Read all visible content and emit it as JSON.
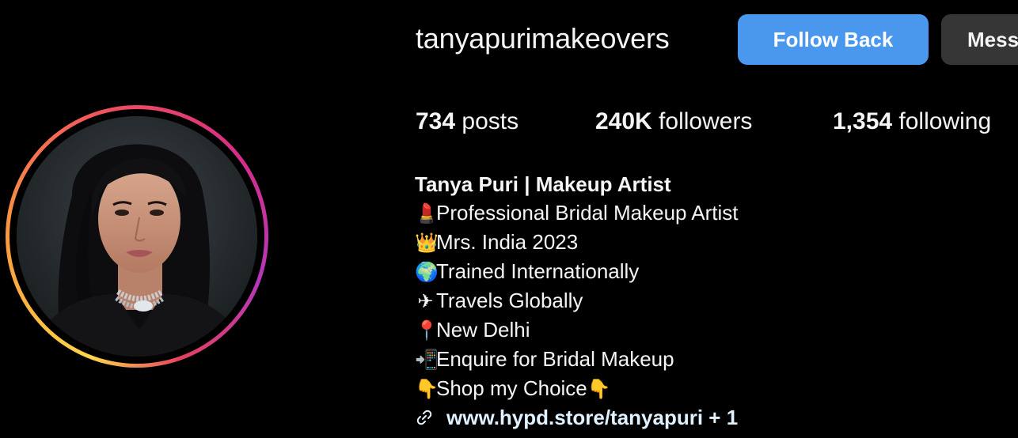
{
  "profile": {
    "username": "tanyapurimakeovers",
    "avatar_alt": "profile-photo"
  },
  "actions": {
    "follow_back_label": "Follow Back",
    "message_label": "Message"
  },
  "stats": {
    "posts_count": "734",
    "posts_label": " posts",
    "followers_count": "240K",
    "followers_label": " followers",
    "following_count": "1,354",
    "following_label": " following"
  },
  "bio": {
    "name": "Tanya Puri | Makeup Artist",
    "lines": [
      {
        "icon": "lipstick-icon",
        "glyph": "💄",
        "text": "Professional Bridal Makeup Artist"
      },
      {
        "icon": "crown-icon",
        "glyph": "👑",
        "text": "Mrs. India 2023"
      },
      {
        "icon": "globe-icon",
        "glyph": "🌍",
        "text": "Trained Internationally"
      },
      {
        "icon": "airplane-icon",
        "glyph": "✈",
        "text": "Travels Globally"
      },
      {
        "icon": "pin-icon",
        "glyph": "📍",
        "text": "New Delhi"
      },
      {
        "icon": "phone-icon",
        "glyph": "📲",
        "text": "Enquire for Bridal Makeup"
      },
      {
        "icon": "pointing-down-icon",
        "glyph": "👇",
        "text": "Shop my Choice",
        "trailing_glyph": "👇"
      }
    ],
    "link": {
      "text": "www.hypd.store/tanyapuri + 1",
      "icon": "link-icon"
    }
  },
  "colors": {
    "follow_button": "#4a97ee",
    "message_button": "#363636",
    "background": "#000000",
    "text": "#f5f5f5"
  }
}
